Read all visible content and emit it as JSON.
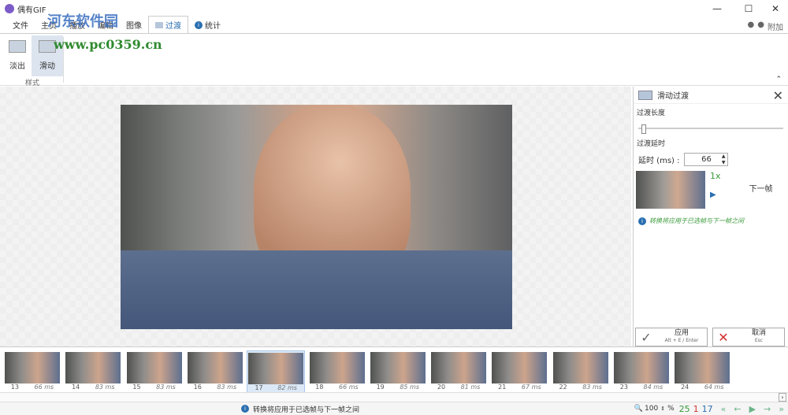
{
  "window": {
    "title": "偶有GIF",
    "minimize": "—",
    "maximize": "☐",
    "close": "✕"
  },
  "tabs": [
    {
      "label": "文件"
    },
    {
      "label": "主页"
    },
    {
      "label": "播放"
    },
    {
      "label": "编辑"
    },
    {
      "label": "图像"
    },
    {
      "label": "过渡",
      "active": true
    },
    {
      "label": "统计"
    }
  ],
  "tab_right": {
    "extra": "附加"
  },
  "ribbon": {
    "buttons": [
      {
        "label": "淡出"
      },
      {
        "label": "滑动",
        "selected": true
      }
    ],
    "group": "样式"
  },
  "watermark": {
    "name": "河东软件园",
    "url": "www.pc0359.cn"
  },
  "panel": {
    "title": "滑动过渡",
    "length_label": "过渡长度",
    "length_value": 0,
    "delay_section": "过渡延时",
    "delay_label": "延时 (ms) :",
    "delay_value": "66",
    "speed": "1x",
    "next_frame": "下一帧",
    "info": "转换将应用于已选帧与下一帧之间",
    "apply": "应用",
    "apply_shortcut": "Alt + E / Enter",
    "cancel": "取消",
    "cancel_shortcut": "Esc"
  },
  "frames": [
    {
      "n": "13",
      "d": "66 ms"
    },
    {
      "n": "14",
      "d": "83 ms"
    },
    {
      "n": "15",
      "d": "83 ms"
    },
    {
      "n": "16",
      "d": "83 ms"
    },
    {
      "n": "17",
      "d": "82 ms",
      "selected": true
    },
    {
      "n": "18",
      "d": "66 ms"
    },
    {
      "n": "19",
      "d": "85 ms"
    },
    {
      "n": "20",
      "d": "81 ms"
    },
    {
      "n": "21",
      "d": "67 ms"
    },
    {
      "n": "22",
      "d": "83 ms"
    },
    {
      "n": "23",
      "d": "84 ms"
    },
    {
      "n": "24",
      "d": "64 ms"
    }
  ],
  "status": {
    "message": "转换将应用于已选帧与下一帧之间",
    "zoom": "100",
    "percent": "%",
    "total": "25",
    "selected": "1",
    "current": "17"
  },
  "colors": {
    "accent": "#2a6fb0",
    "green": "#3a9a3a",
    "red": "#d03030"
  }
}
